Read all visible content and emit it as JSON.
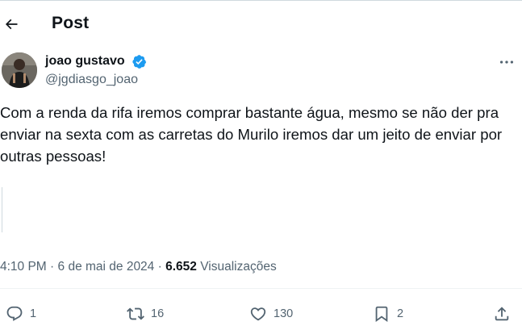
{
  "header": {
    "title": "Post",
    "back_icon": "arrow-left-icon"
  },
  "author": {
    "name": "joao gustavo",
    "handle": "@jgdiasgo_joao",
    "verified_color": "#1d9bf0"
  },
  "post": {
    "text": "Com a renda da rifa iremos comprar bastante água, mesmo se não der pra enviar na sexta com as carretas do Murilo iremos dar um jeito de enviar por outras pessoas!"
  },
  "meta": {
    "time": "4:10 PM",
    "sep1": " · ",
    "date": "6 de mai de 2024",
    "sep2": " · ",
    "views_count": "6.652",
    "views_label": "Visualizações"
  },
  "actions": {
    "replies": "1",
    "reposts": "16",
    "likes": "130",
    "bookmarks": "2"
  },
  "colors": {
    "text": "#0f1419",
    "secondary": "#536471",
    "accent": "#1d9bf0"
  }
}
